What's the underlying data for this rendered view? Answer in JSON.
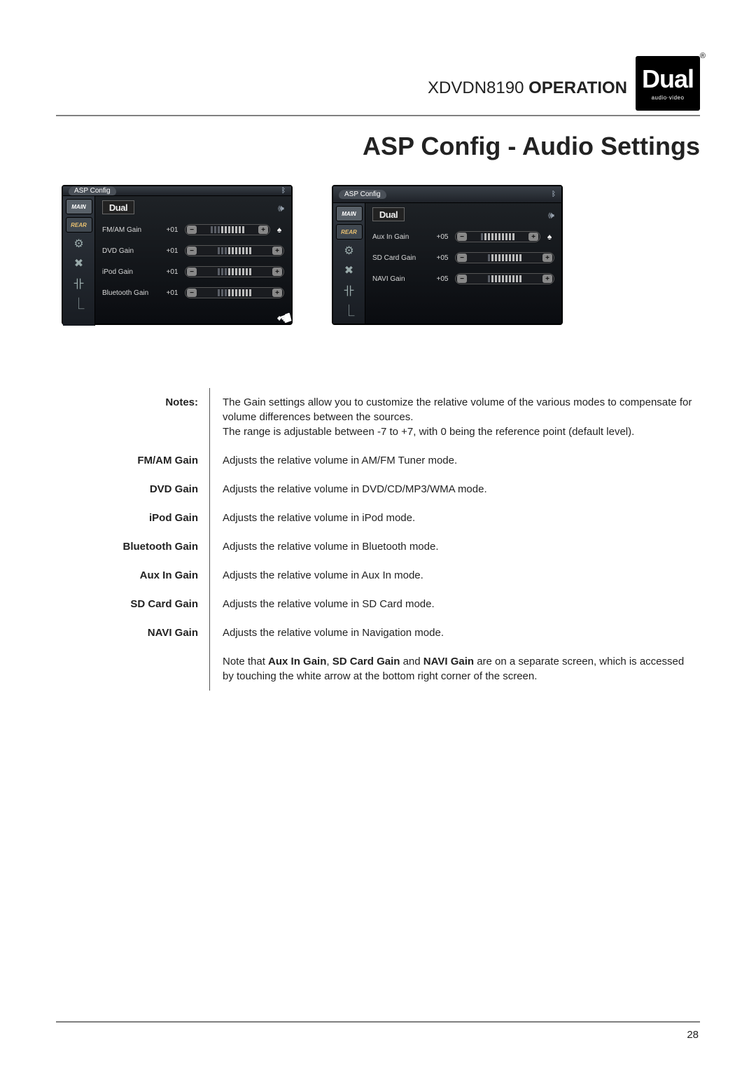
{
  "header": {
    "model": "XDVDN8190",
    "operation_label": "OPERATION",
    "logo_text": "Dual",
    "logo_sub": "audio·video"
  },
  "section_title": "ASP Config - Audio Settings",
  "screens": [
    {
      "title": "ASP Config",
      "logo": "Dual",
      "side_main": "MAIN",
      "side_rear": "REAR",
      "show_hand": true,
      "gains": [
        {
          "label": "FM/AM Gain",
          "value": "+01"
        },
        {
          "label": "DVD Gain",
          "value": "+01"
        },
        {
          "label": "iPod Gain",
          "value": "+01"
        },
        {
          "label": "Bluetooth Gain",
          "value": "+01"
        }
      ]
    },
    {
      "title": "ASP Config",
      "logo": "Dual",
      "side_main": "MAIN",
      "side_rear": "REAR",
      "show_hand": false,
      "gains": [
        {
          "label": "Aux In Gain",
          "value": "+05"
        },
        {
          "label": "SD Card Gain",
          "value": "+05"
        },
        {
          "label": "NAVI Gain",
          "value": "+05"
        }
      ]
    }
  ],
  "notes_label": "Notes:",
  "notes_text": "The Gain settings allow you to customize the relative volume of the various modes to compensate for volume differences between the sources.\nThe range is adjustable between -7 to +7, with 0 being the reference point (default level).",
  "definitions": [
    {
      "label": "FM/AM Gain",
      "desc": "Adjusts the relative volume in AM/FM Tuner mode."
    },
    {
      "label": "DVD Gain",
      "desc": "Adjusts the relative volume in DVD/CD/MP3/WMA mode."
    },
    {
      "label": "iPod Gain",
      "desc": "Adjusts the relative volume in iPod mode."
    },
    {
      "label": "Bluetooth Gain",
      "desc": "Adjusts the relative volume in Bluetooth mode."
    },
    {
      "label": "Aux In Gain",
      "desc": "Adjusts the relative volume in Aux In mode."
    },
    {
      "label": "SD Card Gain",
      "desc": "Adjusts the relative volume in SD Card mode."
    },
    {
      "label": "NAVI Gain",
      "desc": "Adjusts the relative volume in Navigation mode."
    }
  ],
  "footnote_pre": "Note that ",
  "footnote_bold1": "Aux In Gain",
  "footnote_mid1": ", ",
  "footnote_bold2": "SD Card Gain",
  "footnote_mid2": " and ",
  "footnote_bold3": "NAVI Gain",
  "footnote_post": " are on a separate screen, which is accessed by touching the white arrow at the bottom right corner of the screen.",
  "page_number": "28"
}
